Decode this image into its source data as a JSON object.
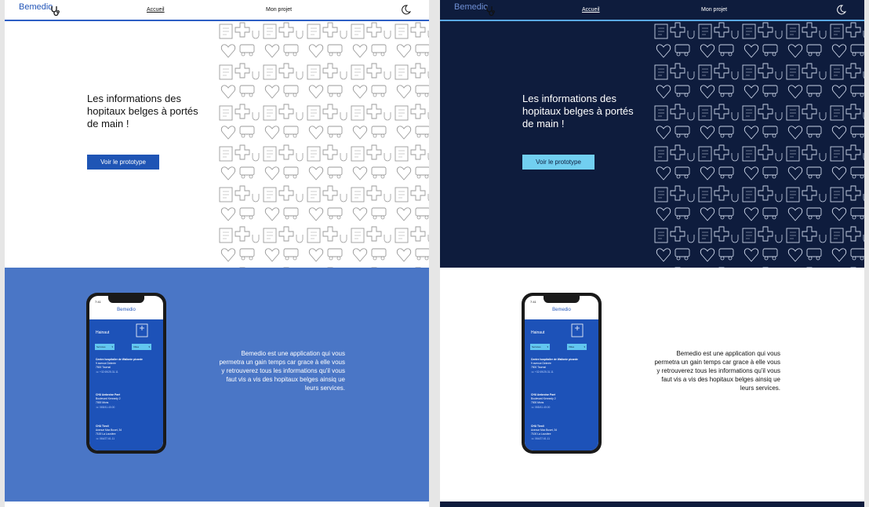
{
  "light": {
    "nav": {
      "logo": "Bemedio",
      "home": "Accueil",
      "project": "Mon projet"
    },
    "hero": {
      "title": "Les informations des hopitaux belges à portés de main !",
      "button": "Voir le prototype"
    },
    "description": "Bemedio est une application qui vous permetra un gain temps car grace à elle vous y retrouverez tous les informations qu'il vous faut vis a vis des hopitaux belges ainsiq ue leurs services.",
    "phone": {
      "time": "7:41",
      "logo": "Bemedio",
      "region": "Hainaut",
      "dropdown_service": "Services",
      "dropdown_city": "Villes",
      "hospitals": [
        {
          "name": "Centre hospitalier de Wallonie picarde",
          "street": "9 avenue Delmée",
          "city": "7500 Tournai",
          "phone": "+32 69/25.31.11"
        },
        {
          "name": "CHU Ambroise Paré",
          "street": "Boulevard Kennedy 2",
          "city": "7000 Mons",
          "phone": "065/41.40.00"
        },
        {
          "name": "CHU Tivoli",
          "street": "Avenue Max Buset, 34",
          "city": "7100 La Louvière",
          "phone": "064/27.61.11"
        }
      ]
    }
  },
  "dark": {
    "nav": {
      "logo": "Bemedio",
      "home": "Accueil",
      "project": "Mon projet"
    },
    "hero": {
      "title": "Les informations des hopitaux belges à portés de main !",
      "button": "Voir le prototype"
    },
    "description": "Bemedio est une application qui vous permetra un gain temps car grace à elle vous y retrouverez tous les informations qu'il vous faut vis a vis des hopitaux belges ainsiq ue leurs services.",
    "phone": {
      "time": "7:41",
      "logo": "Bemedio",
      "region": "Hainaut",
      "dropdown_service": "Services",
      "dropdown_city": "Villes",
      "hospitals": [
        {
          "name": "Centre hospitalier de Wallonie picarde",
          "street": "9 avenue Delmée",
          "city": "7500 Tournai",
          "phone": "+32 69/25.31.11"
        },
        {
          "name": "CHU Ambroise Paré",
          "street": "Boulevard Kennedy 2",
          "city": "7000 Mons",
          "phone": "065/41.40.00"
        },
        {
          "name": "CHU Tivoli",
          "street": "Avenue Max Buset, 34",
          "city": "7100 La Louvière",
          "phone": "064/27.61.11"
        }
      ]
    }
  },
  "colors": {
    "brand_blue": "#1f55b5",
    "section_blue": "#4a76c6",
    "dark_navy": "#0e1c3d",
    "accent_cyan": "#71cff0"
  },
  "icons": [
    "stethoscope-icon",
    "moon-icon",
    "hospital-icon",
    "phone-icon",
    "chevron-down-icon"
  ]
}
